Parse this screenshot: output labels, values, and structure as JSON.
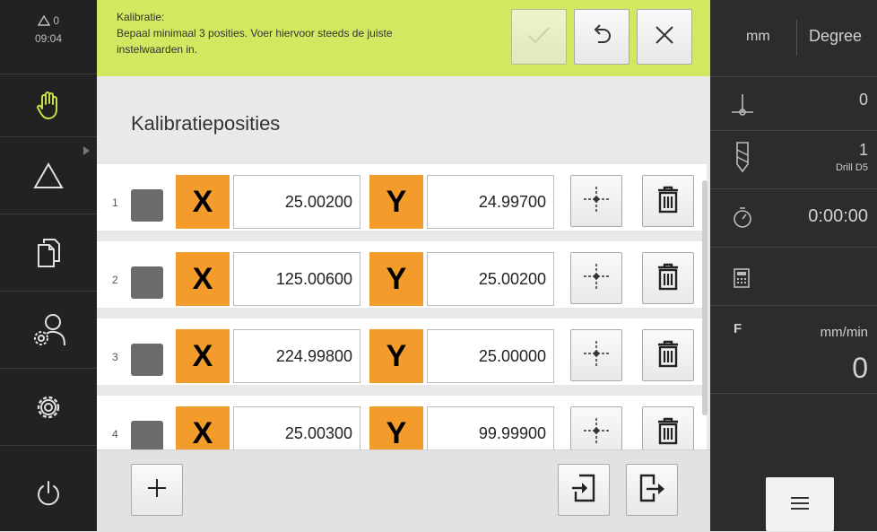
{
  "status": {
    "warnings": "0",
    "time": "09:04"
  },
  "message": {
    "title": "Kalibratie:",
    "line1": "Bepaal minimaal 3 posities. Voer hiervoor steeds de juiste",
    "line2": "instelwaarden in."
  },
  "page_title": "Kalibratieposities",
  "positions": [
    {
      "num": "1",
      "x_label": "X",
      "x": "25.00200",
      "y_label": "Y",
      "y": "24.99700"
    },
    {
      "num": "2",
      "x_label": "X",
      "x": "125.00600",
      "y_label": "Y",
      "y": "25.00200"
    },
    {
      "num": "3",
      "x_label": "X",
      "x": "224.99800",
      "y_label": "Y",
      "y": "25.00000"
    },
    {
      "num": "4",
      "x_label": "X",
      "x": "25.00300",
      "y_label": "Y",
      "y": "99.99900"
    }
  ],
  "right_panel": {
    "unit_length": "mm",
    "unit_angle": "Degree",
    "datum_value": "0",
    "tool_number": "1",
    "tool_name": "Drill D5",
    "timer": "0:00:00",
    "feed_label": "F",
    "feed_unit": "mm/min",
    "feed_value": "0"
  },
  "icons": [
    "warning-triangle-icon",
    "hand-manual-icon",
    "measure-triangle-icon",
    "documents-icon",
    "user-settings-icon",
    "gear-icon",
    "power-icon",
    "check-icon",
    "undo-icon",
    "close-icon",
    "crosshair-capture-icon",
    "trash-icon",
    "plus-icon",
    "import-icon",
    "export-icon",
    "datum-icon",
    "drill-icon",
    "stopwatch-icon",
    "calculator-icon",
    "menu-icon"
  ],
  "colors": {
    "accent_orange": "#f39c2b",
    "message_bg": "#d2e860",
    "sidebar_bg": "#222222",
    "panel_bg": "#2c2c2c"
  }
}
